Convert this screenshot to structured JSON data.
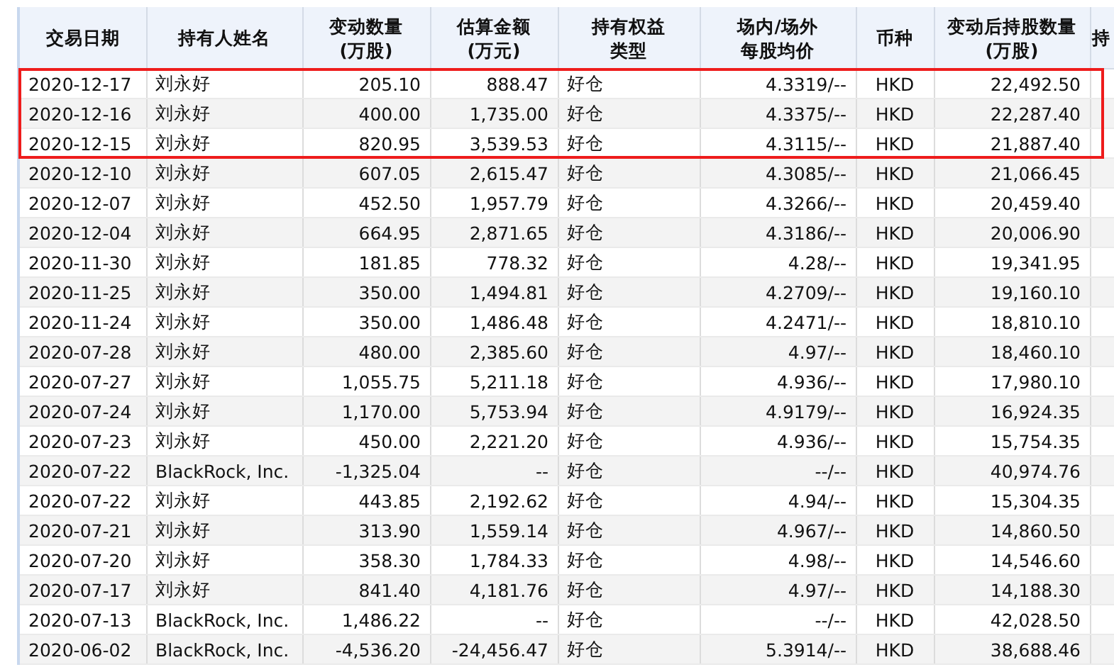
{
  "table": {
    "columns": [
      {
        "lines": [
          "交易日期"
        ]
      },
      {
        "lines": [
          "持有人姓名"
        ]
      },
      {
        "lines": [
          "变动数量",
          "(万股)"
        ]
      },
      {
        "lines": [
          "估算金额",
          "(万元)"
        ]
      },
      {
        "lines": [
          "持有权益",
          "类型"
        ]
      },
      {
        "lines": [
          "场内/场外",
          "每股均价"
        ]
      },
      {
        "lines": [
          "币种"
        ]
      },
      {
        "lines": [
          "变动后持股数量",
          "(万股)"
        ]
      },
      {
        "lines": [
          "持"
        ]
      }
    ],
    "rows": [
      {
        "highlighted": true,
        "cells": [
          "2020-12-17",
          "刘永好",
          "205.10",
          "888.47",
          "好仓",
          "4.3319/--",
          "HKD",
          "22,492.50"
        ]
      },
      {
        "highlighted": true,
        "cells": [
          "2020-12-16",
          "刘永好",
          "400.00",
          "1,735.00",
          "好仓",
          "4.3375/--",
          "HKD",
          "22,287.40"
        ]
      },
      {
        "highlighted": true,
        "cells": [
          "2020-12-15",
          "刘永好",
          "820.95",
          "3,539.53",
          "好仓",
          "4.3115/--",
          "HKD",
          "21,887.40"
        ]
      },
      {
        "highlighted": false,
        "cells": [
          "2020-12-10",
          "刘永好",
          "607.05",
          "2,615.47",
          "好仓",
          "4.3085/--",
          "HKD",
          "21,066.45"
        ]
      },
      {
        "highlighted": false,
        "cells": [
          "2020-12-07",
          "刘永好",
          "452.50",
          "1,957.79",
          "好仓",
          "4.3266/--",
          "HKD",
          "20,459.40"
        ]
      },
      {
        "highlighted": false,
        "cells": [
          "2020-12-04",
          "刘永好",
          "664.95",
          "2,871.65",
          "好仓",
          "4.3186/--",
          "HKD",
          "20,006.90"
        ]
      },
      {
        "highlighted": false,
        "cells": [
          "2020-11-30",
          "刘永好",
          "181.85",
          "778.32",
          "好仓",
          "4.28/--",
          "HKD",
          "19,341.95"
        ]
      },
      {
        "highlighted": false,
        "cells": [
          "2020-11-25",
          "刘永好",
          "350.00",
          "1,494.81",
          "好仓",
          "4.2709/--",
          "HKD",
          "19,160.10"
        ]
      },
      {
        "highlighted": false,
        "cells": [
          "2020-11-24",
          "刘永好",
          "350.00",
          "1,486.48",
          "好仓",
          "4.2471/--",
          "HKD",
          "18,810.10"
        ]
      },
      {
        "highlighted": false,
        "cells": [
          "2020-07-28",
          "刘永好",
          "480.00",
          "2,385.60",
          "好仓",
          "4.97/--",
          "HKD",
          "18,460.10"
        ]
      },
      {
        "highlighted": false,
        "cells": [
          "2020-07-27",
          "刘永好",
          "1,055.75",
          "5,211.18",
          "好仓",
          "4.936/--",
          "HKD",
          "17,980.10"
        ]
      },
      {
        "highlighted": false,
        "cells": [
          "2020-07-24",
          "刘永好",
          "1,170.00",
          "5,753.94",
          "好仓",
          "4.9179/--",
          "HKD",
          "16,924.35"
        ]
      },
      {
        "highlighted": false,
        "cells": [
          "2020-07-23",
          "刘永好",
          "450.00",
          "2,221.20",
          "好仓",
          "4.936/--",
          "HKD",
          "15,754.35"
        ]
      },
      {
        "highlighted": false,
        "cells": [
          "2020-07-22",
          "BlackRock, Inc.",
          "-1,325.04",
          "--",
          "好仓",
          "--/--",
          "HKD",
          "40,974.76"
        ]
      },
      {
        "highlighted": false,
        "cells": [
          "2020-07-22",
          "刘永好",
          "443.85",
          "2,192.62",
          "好仓",
          "4.94/--",
          "HKD",
          "15,304.35"
        ]
      },
      {
        "highlighted": false,
        "cells": [
          "2020-07-21",
          "刘永好",
          "313.90",
          "1,559.14",
          "好仓",
          "4.967/--",
          "HKD",
          "14,860.50"
        ]
      },
      {
        "highlighted": false,
        "cells": [
          "2020-07-20",
          "刘永好",
          "358.30",
          "1,784.33",
          "好仓",
          "4.98/--",
          "HKD",
          "14,546.60"
        ]
      },
      {
        "highlighted": false,
        "cells": [
          "2020-07-17",
          "刘永好",
          "841.40",
          "4,181.76",
          "好仓",
          "4.97/--",
          "HKD",
          "14,188.30"
        ]
      },
      {
        "highlighted": false,
        "cells": [
          "2020-07-13",
          "BlackRock, Inc.",
          "1,486.22",
          "--",
          "好仓",
          "--/--",
          "HKD",
          "42,028.50"
        ]
      },
      {
        "highlighted": false,
        "cells": [
          "2020-06-02",
          "BlackRock, Inc.",
          "-4,536.20",
          "-24,456.47",
          "好仓",
          "5.3914/--",
          "HKD",
          "38,688.46"
        ]
      }
    ]
  }
}
